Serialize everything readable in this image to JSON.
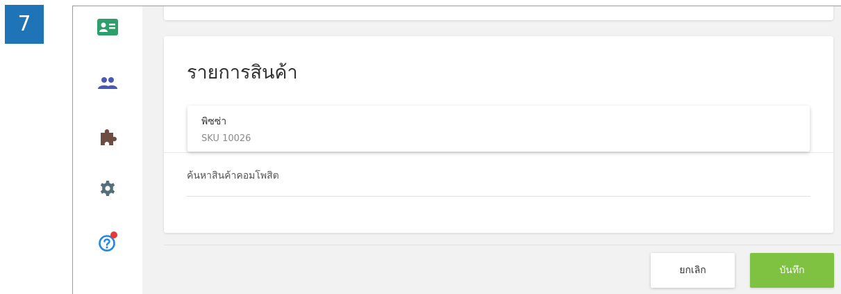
{
  "step_badge": "7",
  "sidebar": {
    "items": [
      {
        "icon": "id-card-icon",
        "color": "#2e9e6b"
      },
      {
        "icon": "users-icon",
        "color": "#4a58b8"
      },
      {
        "icon": "puzzle-icon",
        "color": "#6d4c41"
      },
      {
        "icon": "gear-icon",
        "color": "#546e7a"
      },
      {
        "icon": "help-icon",
        "color": "#1e88e5",
        "notification": true
      }
    ]
  },
  "card": {
    "title": "รายการสินค้า",
    "product": {
      "name": "พิซซ่า",
      "sku": "SKU 10026"
    },
    "search": {
      "placeholder": "ค้นหาสินค้าคอมโพสิต",
      "value": ""
    }
  },
  "footer": {
    "cancel_label": "ยกเลิก",
    "save_label": "บันทึก"
  },
  "colors": {
    "accent_green": "#7fc241",
    "badge_blue": "#1f73b7",
    "notification_red": "#e53935"
  }
}
